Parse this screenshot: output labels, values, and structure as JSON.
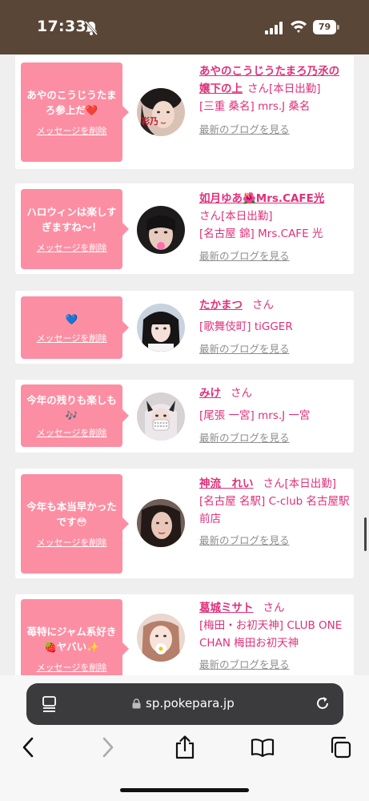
{
  "status_bar": {
    "time": "17:33",
    "battery": "79"
  },
  "cards": [
    {
      "message": "あやのこうじうたまろ参上だ❤️",
      "delete_label": "メッセージを削除",
      "name": "あやのこうじうたまろ乃氶の嬢下の上",
      "san": "さん",
      "status": "[本日出勤]",
      "shop": "[三重 桑名] mrs.J 桑名",
      "blog_link": "最新のブログを見る",
      "avatar_text": "彩乃"
    },
    {
      "message": "ハロウィンは楽しすぎますね〜！",
      "delete_label": "メッセージを削除",
      "name": "如月ゆあ🌺Mrs.CAFE光",
      "san": "さん",
      "status": "[本日出勤]",
      "shop": "[名古屋 錦] Mrs.CAFE 光",
      "blog_link": "最新のブログを見る"
    },
    {
      "message": "💙",
      "delete_label": "メッセージを削除",
      "name": "たかまつ",
      "san": "さん",
      "status": "",
      "shop": "[歌舞伎町] tiGGER",
      "blog_link": "最新のブログを見る"
    },
    {
      "message": "今年の残りも楽しも🎶",
      "delete_label": "メッセージを削除",
      "name": "みけ",
      "san": "さん",
      "status": "",
      "shop": "[尾張 一宮] mrs.J 一宮",
      "blog_link": "最新のブログを見る"
    },
    {
      "message": "今年も本当早かったです😳",
      "delete_label": "メッセージを削除",
      "name": "神流　れい",
      "san": "さん",
      "status": "[本日出勤]",
      "shop": "[名古屋 名駅] C-club 名古屋駅前店",
      "blog_link": "最新のブログを見る"
    },
    {
      "message": "苺特にジャム系好き🍓ヤバい✨",
      "delete_label": "メッセージを削除",
      "name": "葛城ミサト",
      "san": "さん",
      "status": "",
      "shop": "[梅田・お初天神] CLUB ONE CHAN 梅田お初天神",
      "blog_link": "最新のブログを見る"
    }
  ],
  "browser": {
    "url": "sp.pokepara.jp"
  },
  "colors": {
    "accent_pink": "#e0307a",
    "bubble_pink": "#fc8ea3",
    "status_bar_brown": "#594636"
  }
}
